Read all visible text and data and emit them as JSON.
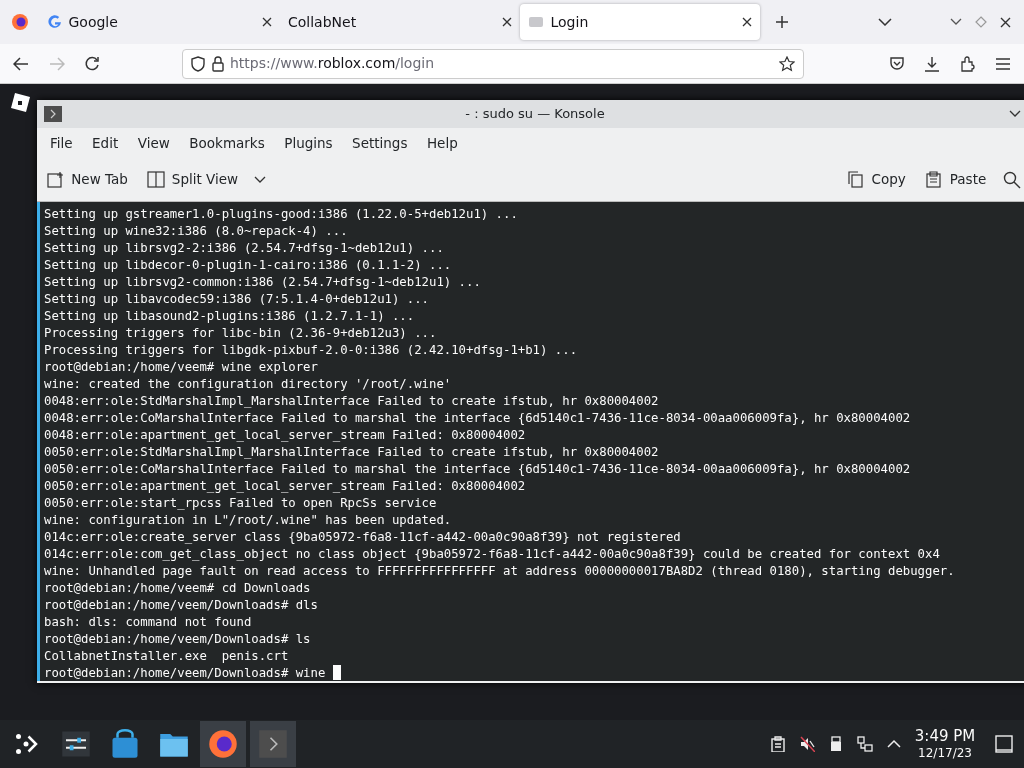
{
  "browser": {
    "tabs": [
      {
        "title": "Google",
        "kind": "google",
        "selected": false
      },
      {
        "title": "CollabNet",
        "kind": "blank",
        "selected": false
      },
      {
        "title": "Login",
        "kind": "page",
        "selected": true
      }
    ],
    "url": {
      "prefix": "https://www.",
      "domain": "roblox.com",
      "path": "/login"
    }
  },
  "konsole": {
    "title": "- : sudo su — Konsole",
    "menu": [
      "File",
      "Edit",
      "View",
      "Bookmarks",
      "Plugins",
      "Settings",
      "Help"
    ],
    "toolbar_left": [
      {
        "label": "New Tab",
        "kind": "newtab"
      },
      {
        "label": "Split View",
        "kind": "split"
      }
    ],
    "toolbar_right": [
      {
        "label": "Copy",
        "kind": "copy"
      },
      {
        "label": "Paste",
        "kind": "paste"
      }
    ],
    "lines": [
      "Setting up gstreamer1.0-plugins-good:i386 (1.22.0-5+deb12u1) ...",
      "Setting up wine32:i386 (8.0~repack-4) ...",
      "Setting up librsvg2-2:i386 (2.54.7+dfsg-1~deb12u1) ...",
      "Setting up libdecor-0-plugin-1-cairo:i386 (0.1.1-2) ...",
      "Setting up librsvg2-common:i386 (2.54.7+dfsg-1~deb12u1) ...",
      "Setting up libavcodec59:i386 (7:5.1.4-0+deb12u1) ...",
      "Setting up libasound2-plugins:i386 (1.2.7.1-1) ...",
      "Processing triggers for libc-bin (2.36-9+deb12u3) ...",
      "Processing triggers for libgdk-pixbuf-2.0-0:i386 (2.42.10+dfsg-1+b1) ...",
      "root@debian:/home/veem# wine explorer",
      "wine: created the configuration directory '/root/.wine'",
      "0048:err:ole:StdMarshalImpl_MarshalInterface Failed to create ifstub, hr 0x80004002",
      "0048:err:ole:CoMarshalInterface Failed to marshal the interface {6d5140c1-7436-11ce-8034-00aa006009fa}, hr 0x80004002",
      "0048:err:ole:apartment_get_local_server_stream Failed: 0x80004002",
      "0050:err:ole:StdMarshalImpl_MarshalInterface Failed to create ifstub, hr 0x80004002",
      "0050:err:ole:CoMarshalInterface Failed to marshal the interface {6d5140c1-7436-11ce-8034-00aa006009fa}, hr 0x80004002",
      "0050:err:ole:apartment_get_local_server_stream Failed: 0x80004002",
      "0050:err:ole:start_rpcss Failed to open RpcSs service",
      "wine: configuration in L\"/root/.wine\" has been updated.",
      "014c:err:ole:create_server class {9ba05972-f6a8-11cf-a442-00a0c90a8f39} not registered",
      "014c:err:ole:com_get_class_object no class object {9ba05972-f6a8-11cf-a442-00a0c90a8f39} could be created for context 0x4",
      "wine: Unhandled page fault on read access to FFFFFFFFFFFFFFFF at address 00000000017BA8D2 (thread 0180), starting debugger.",
      "root@debian:/home/veem# cd Downloads",
      "root@debian:/home/veem/Downloads# dls",
      "bash: dls: command not found",
      "root@debian:/home/veem/Downloads# ls",
      "CollabnetInstaller.exe  penis.crt",
      "root@debian:/home/veem/Downloads# wine "
    ]
  },
  "taskbar": {
    "apps": [
      {
        "kind": "launcher",
        "active": false
      },
      {
        "kind": "settings",
        "active": false
      },
      {
        "kind": "store",
        "active": false
      },
      {
        "kind": "files",
        "active": false
      },
      {
        "kind": "firefox",
        "active": true
      },
      {
        "kind": "terminal",
        "active": true
      }
    ],
    "tray": [
      {
        "kind": "clipboard"
      },
      {
        "kind": "volume-muted"
      },
      {
        "kind": "usb"
      },
      {
        "kind": "network"
      },
      {
        "kind": "expand"
      }
    ],
    "time": "3:49 PM",
    "date": "12/17/23"
  }
}
